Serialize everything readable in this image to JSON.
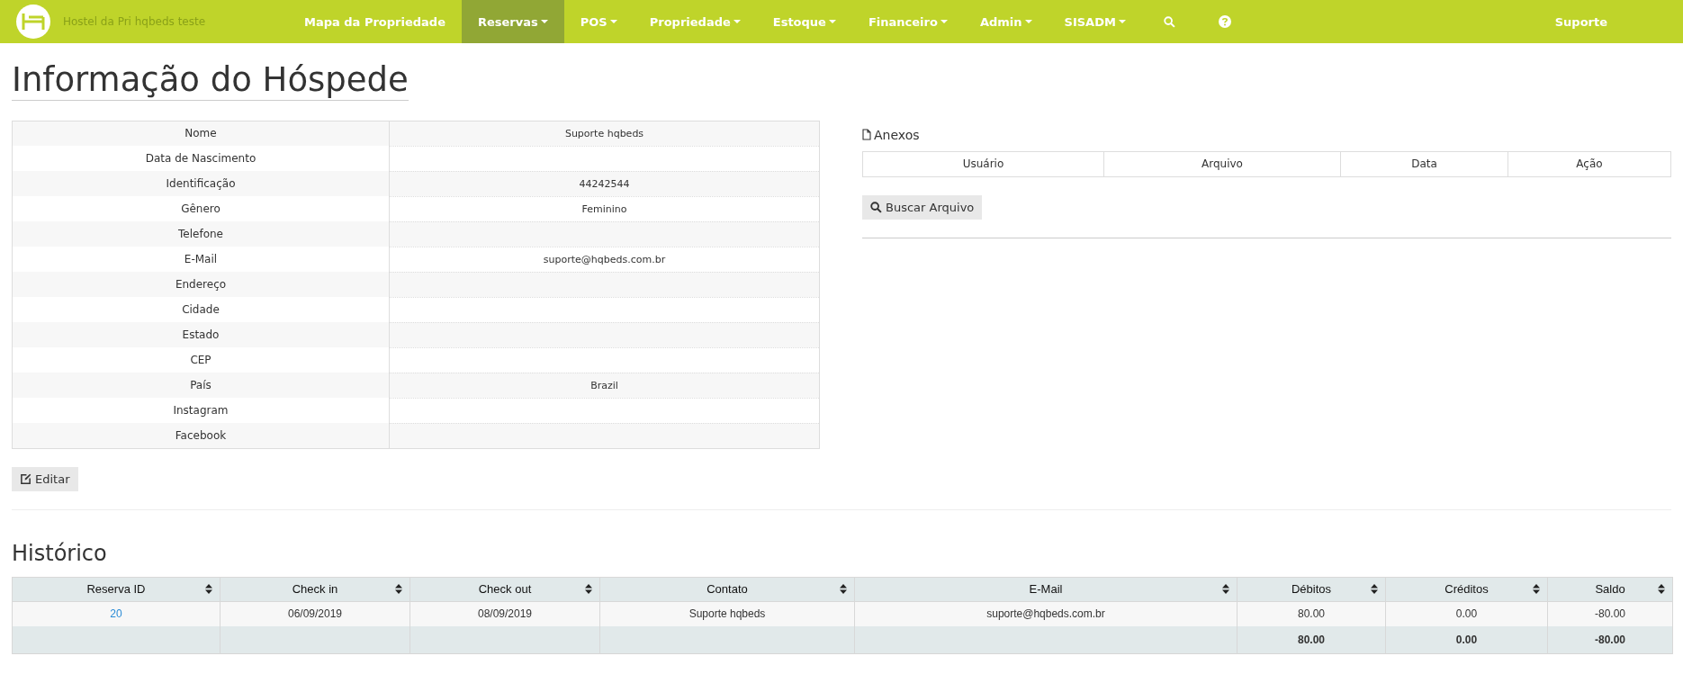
{
  "navbar": {
    "brand": "Hostel da Pri hqbeds teste",
    "items": [
      {
        "label": "Mapa da Propriedade",
        "kind": "link",
        "dropdown": false,
        "selected": false
      },
      {
        "label": "Reservas",
        "kind": "link",
        "dropdown": true,
        "selected": true
      },
      {
        "label": "POS",
        "kind": "link",
        "dropdown": true,
        "selected": false
      },
      {
        "label": "Propriedade",
        "kind": "link",
        "dropdown": true,
        "selected": false
      },
      {
        "label": "Estoque",
        "kind": "link",
        "dropdown": true,
        "selected": false
      },
      {
        "label": "Financeiro",
        "kind": "link",
        "dropdown": true,
        "selected": false
      },
      {
        "label": "Admin",
        "kind": "link",
        "dropdown": true,
        "selected": false
      },
      {
        "label": "SISADM",
        "kind": "link",
        "dropdown": true,
        "selected": false
      },
      {
        "kind": "search",
        "selected": false
      },
      {
        "kind": "help",
        "selected": false
      }
    ],
    "user": "Suporte"
  },
  "page_title": "Informação do Hóspede",
  "guest_info": [
    {
      "label": "Nome",
      "value": "Suporte hqbeds"
    },
    {
      "label": "Data de Nascimento"
    },
    {
      "label": "Identificação",
      "value": "44242544"
    },
    {
      "label": "Gênero",
      "value": "Feminino"
    },
    {
      "label": "Telefone"
    },
    {
      "label": "E-Mail",
      "value": "suporte@hqbeds.com.br"
    },
    {
      "label": "Endereço"
    },
    {
      "label": "Cidade"
    },
    {
      "label": "Estado"
    },
    {
      "label": "CEP"
    },
    {
      "label": "País",
      "value": "Brazil"
    },
    {
      "label": "Instagram"
    },
    {
      "label": "Facebook"
    }
  ],
  "edit_button": "Editar",
  "attachments": {
    "title": "Anexos",
    "columns": [
      "Usuário",
      "Arquivo",
      "Data",
      "Ação"
    ],
    "button": "Buscar Arquivo"
  },
  "history": {
    "title": "Histórico",
    "columns": [
      "Reserva ID",
      "Check in",
      "Check out",
      "Contato",
      "E-Mail",
      "Débitos",
      "Créditos",
      "Saldo"
    ],
    "rows": [
      {
        "cells": [
          "20",
          "06/09/2019",
          "08/09/2019",
          "Suporte hqbeds",
          "suporte@hqbeds.com.br",
          "80.00",
          "0.00",
          "-80.00"
        ]
      }
    ],
    "totals": [
      "80.00",
      "0.00",
      "-80.00"
    ]
  }
}
